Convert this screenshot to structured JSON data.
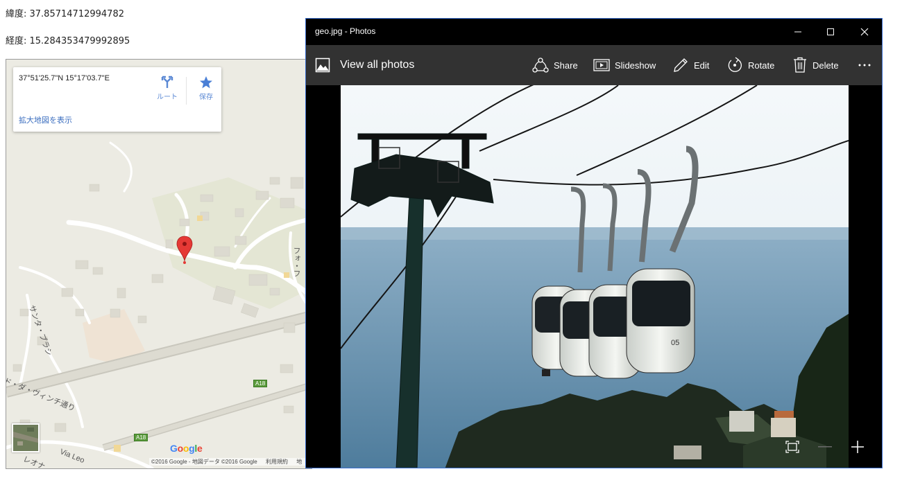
{
  "coords": {
    "latitude_line": "緯度: 37.8571471299478​2",
    "longitude_line": "経度: 15.284353479992895"
  },
  "map": {
    "info_coords": "37°51'25.7\"N 15°17'03.7\"E",
    "route_label": "ルート",
    "save_label": "保存",
    "view_larger_label": "拡大地図を表示",
    "street_labels": [
      "フォ・フ",
      "サンタ・プラシ",
      "ド・ダ・ヴィンチ通り",
      "Via Leo",
      "レオナ"
    ],
    "road_shields": [
      "A18",
      "A18"
    ],
    "google_logo": "Google",
    "footer": {
      "copyright": "©2016 Google - 地図データ ©2016 Google",
      "terms": "利用規約",
      "extra": "地"
    },
    "colors": {
      "marker": "#e53935",
      "accent": "#4a7fd6"
    }
  },
  "photos_window": {
    "title": "geo.jpg - Photos",
    "view_all": "View all photos",
    "toolbar": {
      "share": "Share",
      "slideshow": "Slideshow",
      "edit": "Edit",
      "rotate": "Rotate",
      "delete": "Delete"
    },
    "icons": {
      "minimize": "minimize-icon",
      "maximize": "maximize-icon",
      "close": "close-icon",
      "more": "more-icon",
      "fit": "fit-screen-icon",
      "zoom_out": "zoom-out-icon",
      "zoom_in": "zoom-in-icon"
    },
    "photo_car_number": "05"
  }
}
